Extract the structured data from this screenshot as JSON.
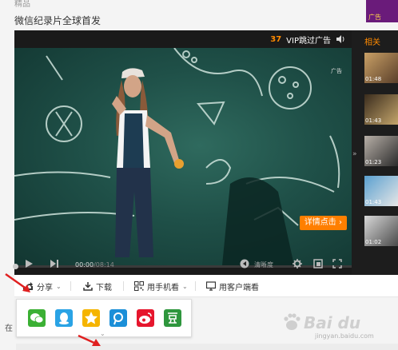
{
  "page": {
    "top_snippet": "精品",
    "title": "微信纪录片全球首发"
  },
  "player": {
    "ad_countdown": "37",
    "vip_skip": "VIP跳过广告",
    "ad_label": "广告",
    "details_button": "详情点击",
    "time_current": "00:00",
    "time_total": "/08:14",
    "quality": "清晰度"
  },
  "related": {
    "title": "相关",
    "thumbs": [
      {
        "time": "01:48"
      },
      {
        "time": "01:43"
      },
      {
        "time": "01:23"
      },
      {
        "time": "01:43"
      },
      {
        "time": "01:02"
      }
    ]
  },
  "toolbar": {
    "share": "分享",
    "download": "下载",
    "mobile": "用手机看",
    "client": "用客户端看"
  },
  "share_targets": [
    {
      "name": "wechat",
      "color": "#3bb034"
    },
    {
      "name": "qq",
      "color": "#2aa3e5"
    },
    {
      "name": "qzone",
      "color": "#f5b400"
    },
    {
      "name": "tencent-weibo",
      "color": "#1b8fd8"
    },
    {
      "name": "sina-weibo",
      "color": "#e6162d"
    },
    {
      "name": "douban",
      "color": "#2e963d"
    }
  ],
  "bottom": {
    "left_letter": "在"
  },
  "watermark": {
    "text": "Bai du",
    "sub": "jingyan.baidu.com"
  },
  "colors": {
    "accent": "#ff7f00",
    "annotation_red": "#e02020"
  }
}
